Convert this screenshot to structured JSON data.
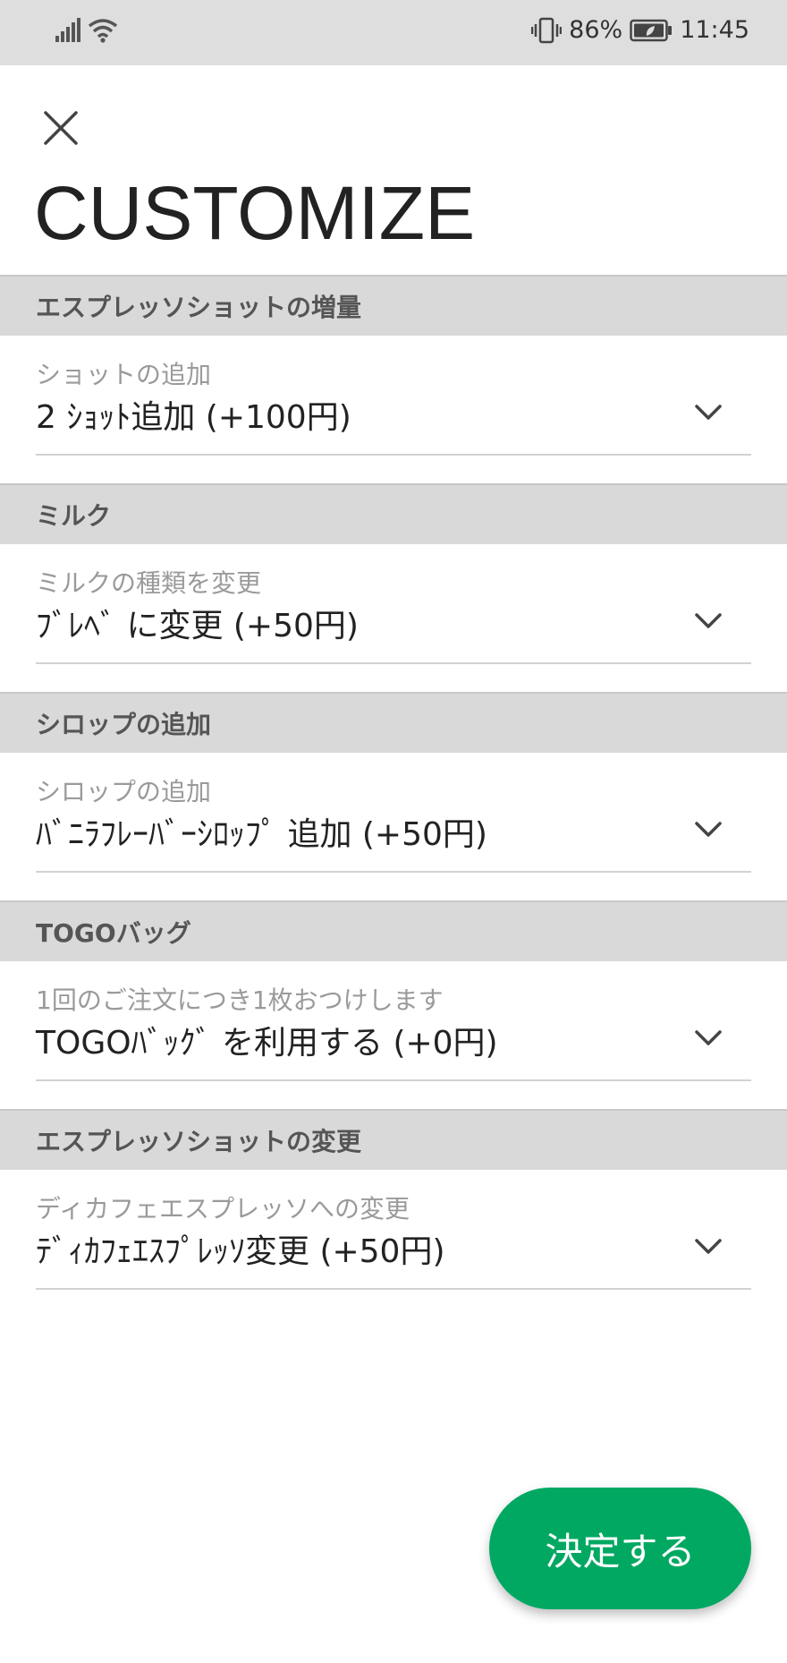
{
  "status_bar": {
    "battery_percent": "86%",
    "time": "11:45"
  },
  "header": {
    "title": "CUSTOMIZE"
  },
  "sections": [
    {
      "title": "エスプレッソショットの増量",
      "label": "ショットの追加",
      "value": "2 ｼｮｯﾄ追加 (+100円)"
    },
    {
      "title": "ミルク",
      "label": "ミルクの種類を変更",
      "value": "ﾌﾞﾚﾍﾞ に変更 (+50円)"
    },
    {
      "title": "シロップの追加",
      "label": "シロップの追加",
      "value": "ﾊﾞﾆﾗﾌﾚｰﾊﾞｰｼﾛｯﾌﾟ 追加 (+50円)"
    },
    {
      "title": "TOGOバッグ",
      "label": "1回のご注文につき1枚おつけします",
      "value": "TOGOﾊﾞｯｸﾞ を利用する (+0円)"
    },
    {
      "title": "エスプレッソショットの変更",
      "label": "ディカフェエスプレッソへの変更",
      "value": "ﾃﾞｨｶﾌｪｴｽﾌﾟﾚｯｿ変更 (+50円)"
    }
  ],
  "confirm_button": {
    "label": "決定する"
  },
  "colors": {
    "accent": "#00a862",
    "section_header_bg": "#d9d9d9",
    "status_bar_bg": "#dedede"
  },
  "icons": {
    "close": "close-icon",
    "chevron": "chevron-down-icon",
    "signal": "signal-icon",
    "wifi": "wifi-icon",
    "vibrate": "vibrate-icon",
    "battery": "battery-icon"
  }
}
